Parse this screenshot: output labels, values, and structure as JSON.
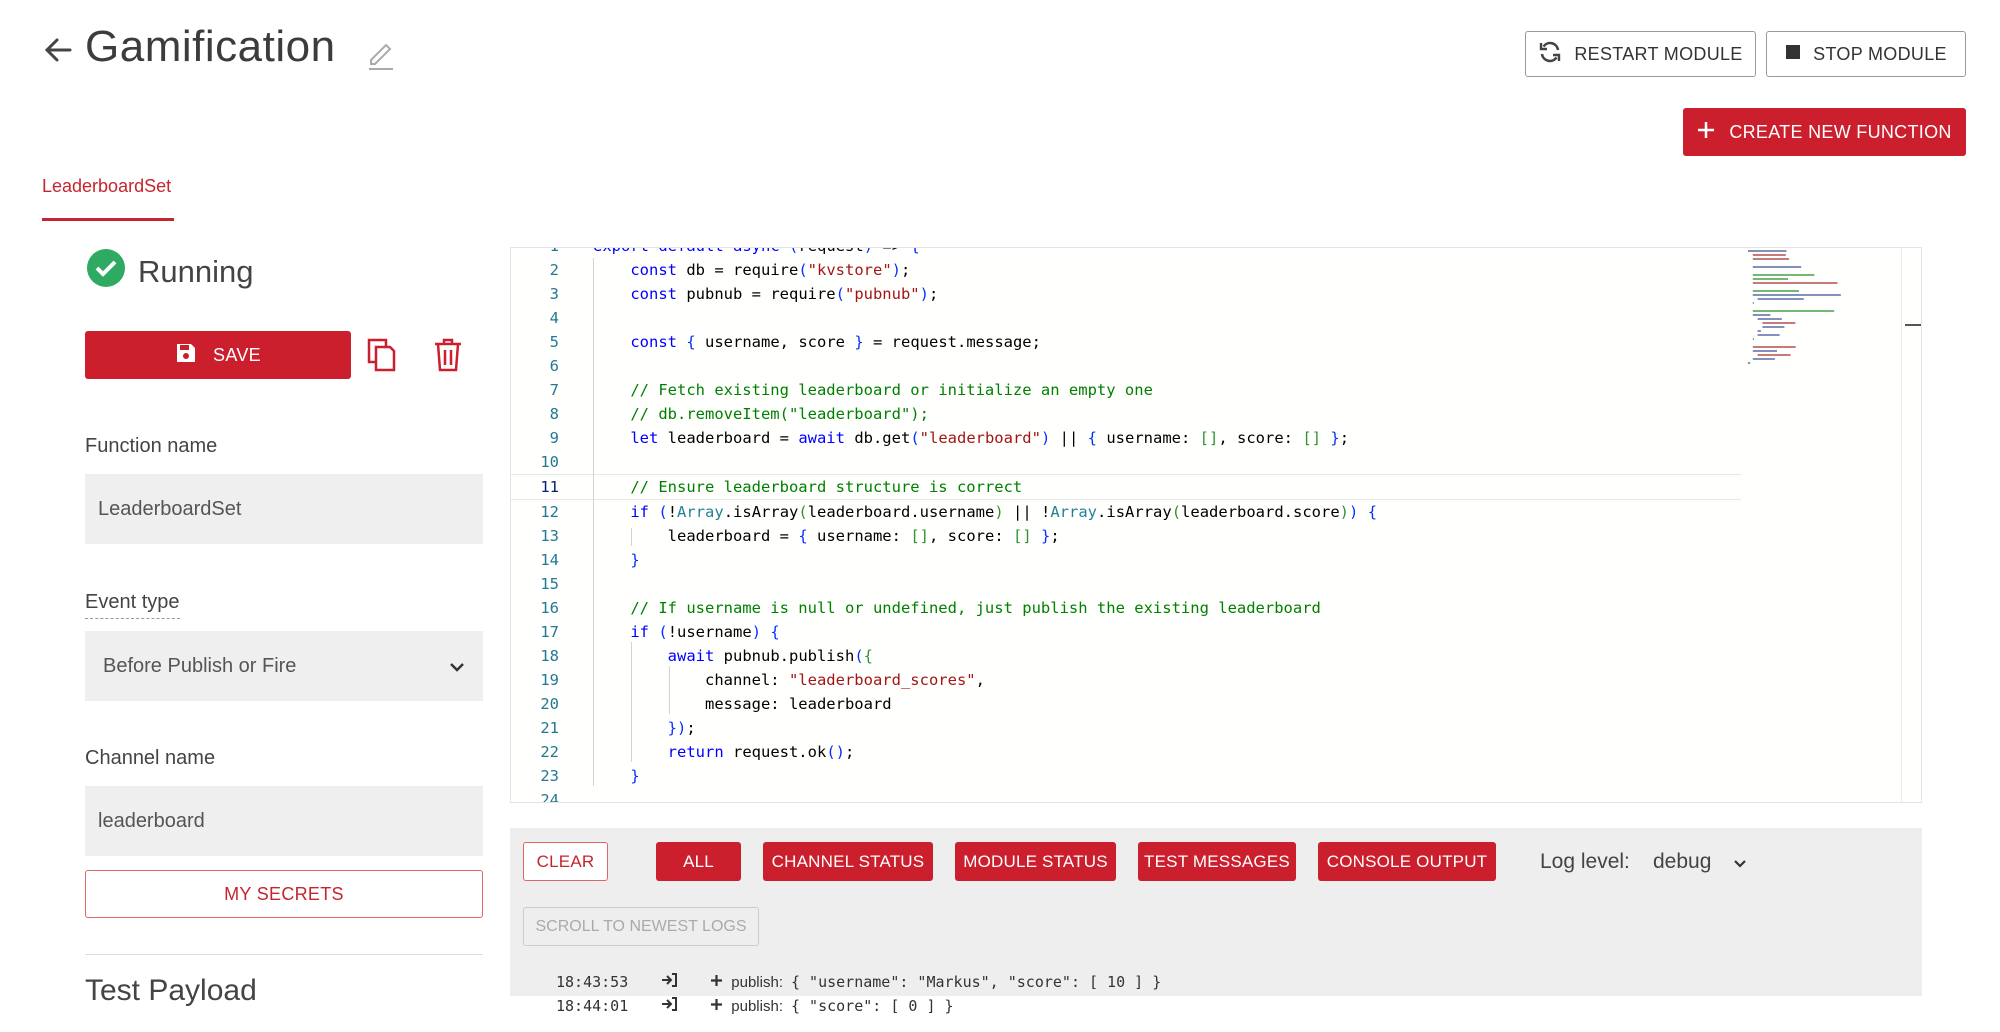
{
  "header": {
    "title": "Gamification",
    "restart_label": "RESTART MODULE",
    "stop_label": "STOP MODULE",
    "create_label": "CREATE NEW FUNCTION"
  },
  "tabs": [
    {
      "label": "LeaderboardSet",
      "active": true
    }
  ],
  "status": {
    "label": "Running",
    "color": "#2eaa62"
  },
  "actions": {
    "save_label": "SAVE"
  },
  "form": {
    "function_name_label": "Function name",
    "function_name_value": "LeaderboardSet",
    "event_type_label": "Event type",
    "event_type_value": "Before Publish or Fire",
    "channel_name_label": "Channel name",
    "channel_name_value": "leaderboard",
    "secrets_label": "MY SECRETS",
    "test_payload_label": "Test Payload"
  },
  "editor": {
    "current_line": 11,
    "lines": [
      "export default async (request) => {",
      "    const db = require(\"kvstore\");",
      "    const pubnub = require(\"pubnub\");",
      "",
      "    const { username, score } = request.message;",
      "",
      "    // Fetch existing leaderboard or initialize an empty one",
      "    // db.removeItem(\"leaderboard\");",
      "    let leaderboard = await db.get(\"leaderboard\") || { username: [], score: [] };",
      "",
      "    // Ensure leaderboard structure is correct",
      "    if (!Array.isArray(leaderboard.username) || !Array.isArray(leaderboard.score)) {",
      "        leaderboard = { username: [], score: [] };",
      "    }",
      "",
      "    // If username is null or undefined, just publish the existing leaderboard",
      "    if (!username) {",
      "        await pubnub.publish({",
      "            channel: \"leaderboard_scores\",",
      "            message: leaderboard",
      "        });",
      "        return request.ok();",
      "    }",
      ""
    ]
  },
  "logs": {
    "clear_label": "CLEAR",
    "filters": [
      "ALL",
      "CHANNEL STATUS",
      "MODULE STATUS",
      "TEST MESSAGES",
      "CONSOLE OUTPUT"
    ],
    "log_level_label": "Log level:",
    "log_level_value": "debug",
    "scroll_label": "SCROLL TO NEWEST LOGS",
    "entries": [
      {
        "time": "18:43:53",
        "action": "publish:",
        "payload": "{ \"username\": \"Markus\", \"score\": [ 10 ] }"
      },
      {
        "time": "18:44:01",
        "action": "publish:",
        "payload": "{ \"score\": [ 0 ] }"
      }
    ]
  }
}
